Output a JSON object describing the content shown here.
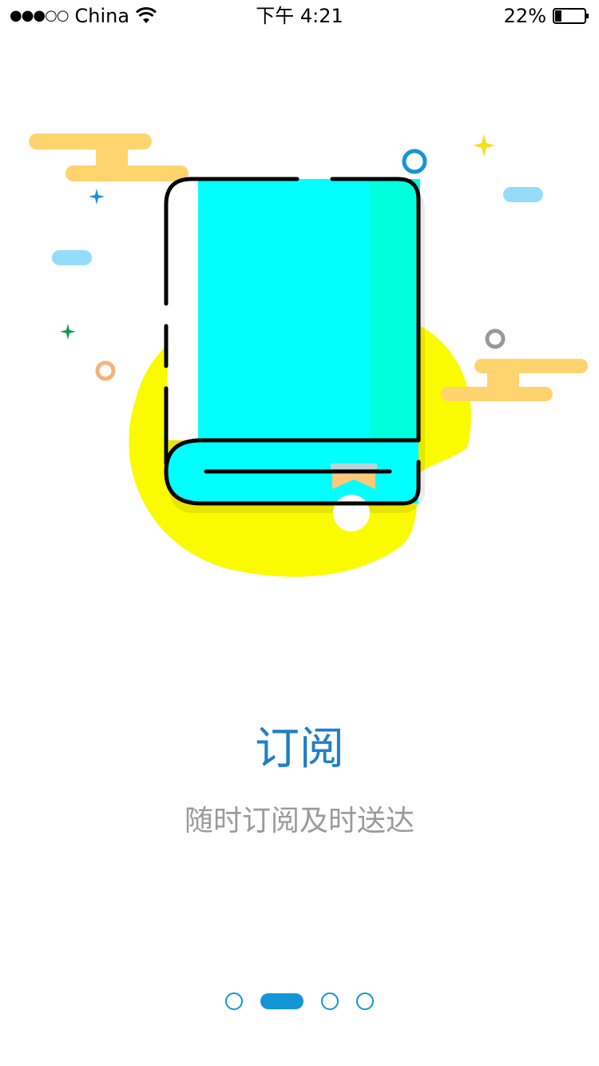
{
  "status_bar": {
    "signal_dots": "●●●○○",
    "carrier": "China",
    "time": "下午 4:21",
    "battery_percent": "22%",
    "battery_level": 0.22
  },
  "onboarding": {
    "title": "订阅",
    "subtitle": "随时订阅及时送达",
    "page_count": 4,
    "active_page": 2
  },
  "colors": {
    "title": "#1f7fc9",
    "subtitle": "#9a9a9a",
    "accent": "#1495d6",
    "book_cover": "#00ffff",
    "blob": "#fafa00",
    "cloud": "#ffd36e"
  },
  "icons": [
    "wifi-icon",
    "battery-icon",
    "book-illustration"
  ]
}
